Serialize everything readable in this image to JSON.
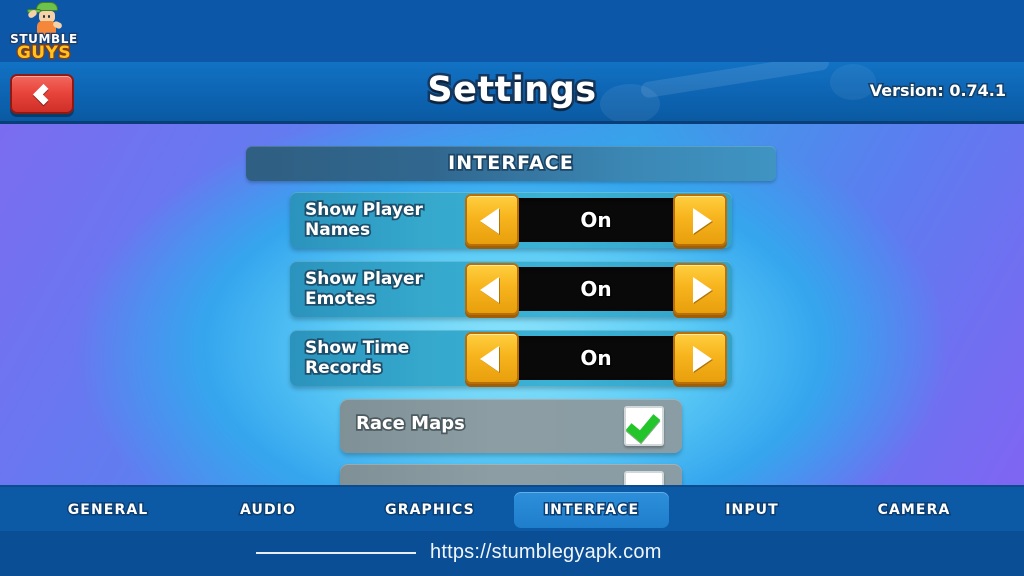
{
  "brand": {
    "logo_line1": "STUMBLE",
    "logo_line2": "GUYS",
    "character_icon": "stumble-guys-character-icon"
  },
  "header": {
    "back_icon": "chevron-left-icon",
    "title": "Settings",
    "version": "Version: 0.74.1"
  },
  "section": {
    "header_label": "INTERFACE"
  },
  "stepper_rows": [
    {
      "label": "Show Player\nNames",
      "label_line1": "Show Player",
      "label_line2": "Names",
      "value": "On",
      "left_icon": "triangle-left-icon",
      "right_icon": "triangle-right-icon"
    },
    {
      "label": "Show Player\nEmotes",
      "label_line1": "Show Player",
      "label_line2": "Emotes",
      "value": "On",
      "left_icon": "triangle-left-icon",
      "right_icon": "triangle-right-icon"
    },
    {
      "label": "Show Time\nRecords",
      "label_line1": "Show Time",
      "label_line2": "Records",
      "value": "On",
      "left_icon": "triangle-left-icon",
      "right_icon": "triangle-right-icon"
    }
  ],
  "toggle_rows": [
    {
      "label": "Race Maps",
      "checked": true,
      "check_icon": "green-check-icon"
    },
    {
      "label": "",
      "checked": false,
      "check_icon": "checkbox-icon"
    }
  ],
  "tabs": [
    {
      "label": "GENERAL",
      "active": false
    },
    {
      "label": "AUDIO",
      "active": false
    },
    {
      "label": "GRAPHICS",
      "active": false
    },
    {
      "label": "INTERFACE",
      "active": true
    },
    {
      "label": "INPUT",
      "active": false
    },
    {
      "label": "CAMERA",
      "active": false
    }
  ],
  "watermark": {
    "url": "https://stumblegyapk.com"
  },
  "colors": {
    "accent_yellow": "#f7b41d",
    "back_red": "#e8453c",
    "check_green": "#24c52b",
    "tab_active_blue": "#2d8fdb",
    "header_blue": "#0d64b2",
    "row_teal": "#35a8cc",
    "toggle_gray": "#8c9ea3"
  }
}
